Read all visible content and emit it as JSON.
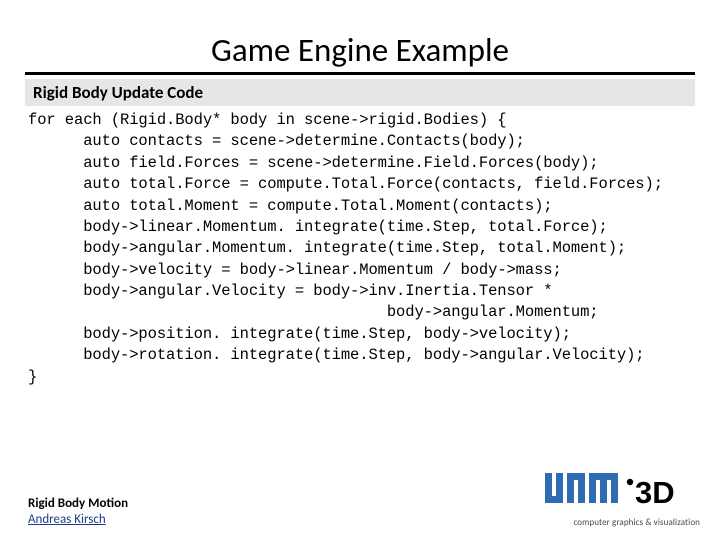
{
  "title": "Game Engine Example",
  "subtitle": "Rigid Body Update Code",
  "code": "for each (Rigid.Body* body in scene->rigid.Bodies) {\n      auto contacts = scene->determine.Contacts(body);\n      auto field.Forces = scene->determine.Field.Forces(body);\n      auto total.Force = compute.Total.Force(contacts, field.Forces);\n      auto total.Moment = compute.Total.Moment(contacts);\n      body->linear.Momentum. integrate(time.Step, total.Force);\n      body->angular.Momentum. integrate(time.Step, total.Moment);\n      body->velocity = body->linear.Momentum / body->mass;\n      body->angular.Velocity = body->inv.Inertia.Tensor *\n                                       body->angular.Momentum;\n      body->position. integrate(time.Step, body->velocity);\n      body->rotation. integrate(time.Step, body->angular.Velocity);\n}",
  "footer": {
    "topic": "Rigid Body Motion",
    "author": "Andreas Kirsch",
    "tagline": "computer graphics & visualization",
    "logo_text": ".3D"
  }
}
